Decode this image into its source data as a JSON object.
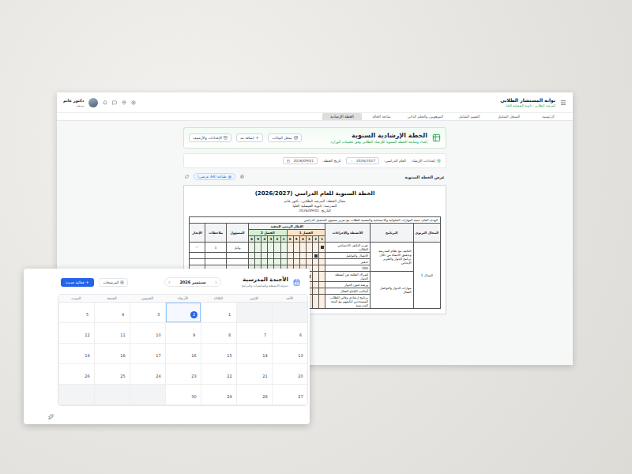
{
  "portal": {
    "title": "بوابة المستشار الطلابي",
    "subtitle": "المرشد الطلابي - ثانوية الفيصلية العليا",
    "user": {
      "name": "دكتور غانم",
      "role": "مرشد"
    },
    "tabs": [
      {
        "label": "الرئيسية",
        "selected": false
      },
      {
        "label": "السجل الشامل",
        "selected": false
      },
      {
        "label": "التقييم الشامل",
        "selected": false
      },
      {
        "label": "الموهوبين والتعلم الذاتي",
        "selected": false
      },
      {
        "label": "متابعة الحالة",
        "selected": false
      },
      {
        "label": "الخطة الإرشادية",
        "selected": true
      }
    ]
  },
  "plan_page": {
    "title": "الخطة الإرشادية السنوية",
    "subtitle": "إعداد ومتابعة الخطة السنوية للإرشاد الطلابي وفق تعليمات الوزارة",
    "actions": [
      "سجل البيانات",
      "إضافة بند",
      "الإعدادات والأرشيف"
    ],
    "settings": {
      "label": "إعدادات الإرشاد:",
      "year_label": "العام الدراسي:",
      "year": "2026/2027",
      "date_label": "تاريخ الخطة:",
      "date": "2026/09/01"
    },
    "view": {
      "title": "عرض الخطة السنوية",
      "print": "طباعة (A4 عرضي)"
    },
    "document": {
      "title": "الخطة السنوية للعام الدراسي (2026/2027)",
      "lines": [
        "مجال الخطة: المرشد الطلابي: دكتور غانم",
        "المدرسة: ثانوية الفيصلية العليا",
        "التاريخ: 2026/09/01"
      ],
      "goal": "الهدف العام: تنمية المهارات السلوكية والاجتماعية والنفسية للطلاب مع تعزيز مستوى التحصيل الدراسي",
      "columns": {
        "domain": "المجال التربوي",
        "program": "البرنامج",
        "actions": "الأنشطة والإجراءات",
        "timeframe": "الإطار الزمني للتنفيذ",
        "owner": "المسؤول",
        "notes": "ملاحظات",
        "done": "الإنجاز"
      },
      "terms": [
        {
          "label": "الفصل 1",
          "color": "#fbe3c8",
          "weeks": [
            "1",
            "2",
            "3",
            "4",
            "5",
            "6"
          ]
        },
        {
          "label": "الفصل 2",
          "color": "#d6eed2",
          "weeks": [
            "1",
            "2",
            "3",
            "4",
            "5",
            "6"
          ]
        }
      ],
      "domain": "المجال 1",
      "programs": [
        {
          "title": "التكيف مع نظام المدرسة وتحقيق الانتماء من خلال برنامج الحوار والتعزيز الإيجابي",
          "actions": [
            {
              "text": "تعزيز التكيف الاجتماعي للطالب",
              "weeks": [
                true,
                false,
                false,
                false,
                false,
                false,
                false,
                false,
                false,
                false,
                false,
                false
              ],
              "owner": "وكيل",
              "note": "1",
              "done": true
            },
            {
              "text": "الاتصال والتواصل",
              "weeks": [
                false,
                true,
                false,
                false,
                false,
                false,
                false,
                false,
                false,
                false,
                false,
                false
              ],
              "done": false
            },
            {
              "text": "تحفيز",
              "weeks": [
                false,
                false,
                false,
                false,
                false,
                false,
                false,
                false,
                false,
                false,
                false,
                false
              ],
              "done": false
            },
            {
              "text": "200",
              "weeks": [
                false,
                false,
                false,
                false,
                false,
                false,
                false,
                false,
                false,
                false,
                false,
                false
              ],
              "done": false
            }
          ]
        },
        {
          "title": "مهارات الحوار والتواصل الفعال",
          "actions": [
            {
              "text": "إشراك الطلبة في أنشطة الحوار",
              "weeks": [
                false,
                false,
                true,
                false,
                false,
                false,
                false,
                false,
                false,
                false,
                false,
                false
              ],
              "done": false
            },
            {
              "text": "ورشة فنون الحوار",
              "weeks": [
                false,
                false,
                false,
                false,
                false,
                false,
                true,
                false,
                false,
                false,
                false,
                false
              ],
              "done": false
            },
            {
              "text": "أساليب الإقناع الفعال",
              "weeks": [
                false,
                false,
                false,
                false,
                false,
                false,
                false,
                false,
                false,
                false,
                false,
                false
              ],
              "done": false
            },
            {
              "text": "برنامج إرشادي وقائي للطلاب المستجدين لتكيفهم مع البيئة المدرسية",
              "weeks": [
                false,
                false,
                false,
                false,
                false,
                false,
                false,
                false,
                false,
                false,
                false,
                false
              ],
              "done": false
            }
          ]
        }
      ]
    }
  },
  "calendar": {
    "title": "الأجندة المدرسية",
    "subtitle": "جدولة الأنشطة والمناسبات والبرامج",
    "month": "سبتمبر 2026",
    "filter": "المرشحات",
    "new_event": "فعالية جديدة",
    "weekdays": [
      "الأحد",
      "الإثنين",
      "الثلاثاء",
      "الأربعاء",
      "الخميس",
      "الجمعة",
      "السبت"
    ],
    "days": [
      {
        "outside": true,
        "today": false
      },
      {
        "outside": true,
        "today": false
      },
      {
        "day": "1",
        "outside": false,
        "today": false
      },
      {
        "day": "2",
        "outside": false,
        "today": true
      },
      {
        "day": "3",
        "outside": false,
        "today": false
      },
      {
        "day": "4",
        "outside": false,
        "today": false
      },
      {
        "day": "5",
        "outside": false,
        "today": false
      },
      {
        "day": "6",
        "outside": false,
        "today": false
      },
      {
        "day": "7",
        "outside": false,
        "today": false
      },
      {
        "day": "8",
        "outside": false,
        "today": false
      },
      {
        "day": "9",
        "outside": false,
        "today": false
      },
      {
        "day": "10",
        "outside": false,
        "today": false
      },
      {
        "day": "11",
        "outside": false,
        "today": false
      },
      {
        "day": "12",
        "outside": false,
        "today": false
      },
      {
        "day": "13",
        "outside": false,
        "today": false
      },
      {
        "day": "14",
        "outside": false,
        "today": false
      },
      {
        "day": "15",
        "outside": false,
        "today": false
      },
      {
        "day": "16",
        "outside": false,
        "today": false
      },
      {
        "day": "17",
        "outside": false,
        "today": false
      },
      {
        "day": "18",
        "outside": false,
        "today": false
      },
      {
        "day": "19",
        "outside": false,
        "today": false
      },
      {
        "day": "20",
        "outside": false,
        "today": false
      },
      {
        "day": "21",
        "outside": false,
        "today": false
      },
      {
        "day": "22",
        "outside": false,
        "today": false
      },
      {
        "day": "23",
        "outside": false,
        "today": false
      },
      {
        "day": "24",
        "outside": false,
        "today": false
      },
      {
        "day": "25",
        "outside": false,
        "today": false
      },
      {
        "day": "26",
        "outside": false,
        "today": false
      },
      {
        "day": "27",
        "outside": false,
        "today": false
      },
      {
        "day": "28",
        "outside": false,
        "today": false
      },
      {
        "day": "29",
        "outside": false,
        "today": false
      },
      {
        "day": "30",
        "outside": false,
        "today": false
      },
      {
        "outside": true,
        "today": false
      },
      {
        "outside": true,
        "today": false
      },
      {
        "outside": true,
        "today": false
      }
    ]
  }
}
